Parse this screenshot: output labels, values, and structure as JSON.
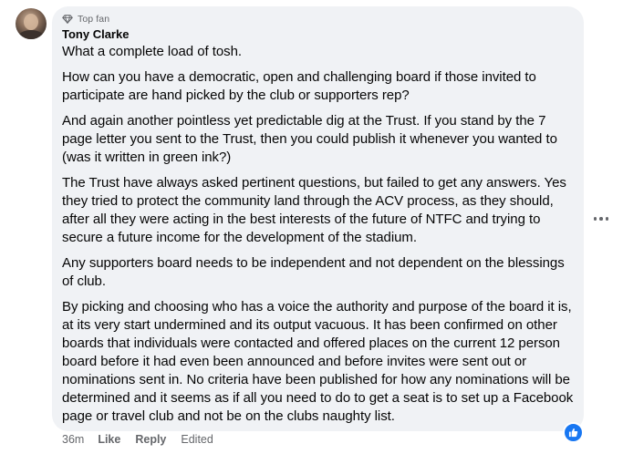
{
  "comment": {
    "badge": "Top fan",
    "author": "Tony Clarke",
    "paragraphs": [
      "What a complete load of tosh.",
      "How can you have a democratic, open and challenging board if those invited to participate are hand picked by the club or supporters rep?",
      "And again another pointless yet predictable dig at the Trust. If you stand by the 7 page letter you sent to the Trust, then you could publish it whenever you wanted to (was it written in green ink?)",
      "The Trust have always asked pertinent questions, but failed to get any answers. Yes they tried to protect the community land through the ACV process, as they should, after all they were acting in the best interests of the future of NTFC and trying to secure a future income for the development of the stadium.",
      "Any supporters board needs to be independent and not dependent on the blessings of club.",
      "By picking and choosing who has a voice the authority and purpose of the board it is, at its very start undermined and its output vacuous. It has been confirmed on other boards that individuals were contacted and offered places on the current 12 person board before it had even been announced and before invites were sent out or nominations sent in. No criteria have been published for how any nominations will be determined and it seems as if all you need to do to get a seat is to set up a Facebook page or travel club and not be on the clubs naughty list."
    ],
    "timestamp": "36m",
    "like_label": "Like",
    "reply_label": "Reply",
    "edited_label": "Edited",
    "reaction_icon": "thumbs-up-icon",
    "badge_icon": "diamond-icon",
    "more_icon": "more-options-icon"
  },
  "colors": {
    "bubble": "#f0f2f5",
    "secondary_text": "#65676b",
    "primary_text": "#050505",
    "reaction_blue": "#1877f2"
  }
}
